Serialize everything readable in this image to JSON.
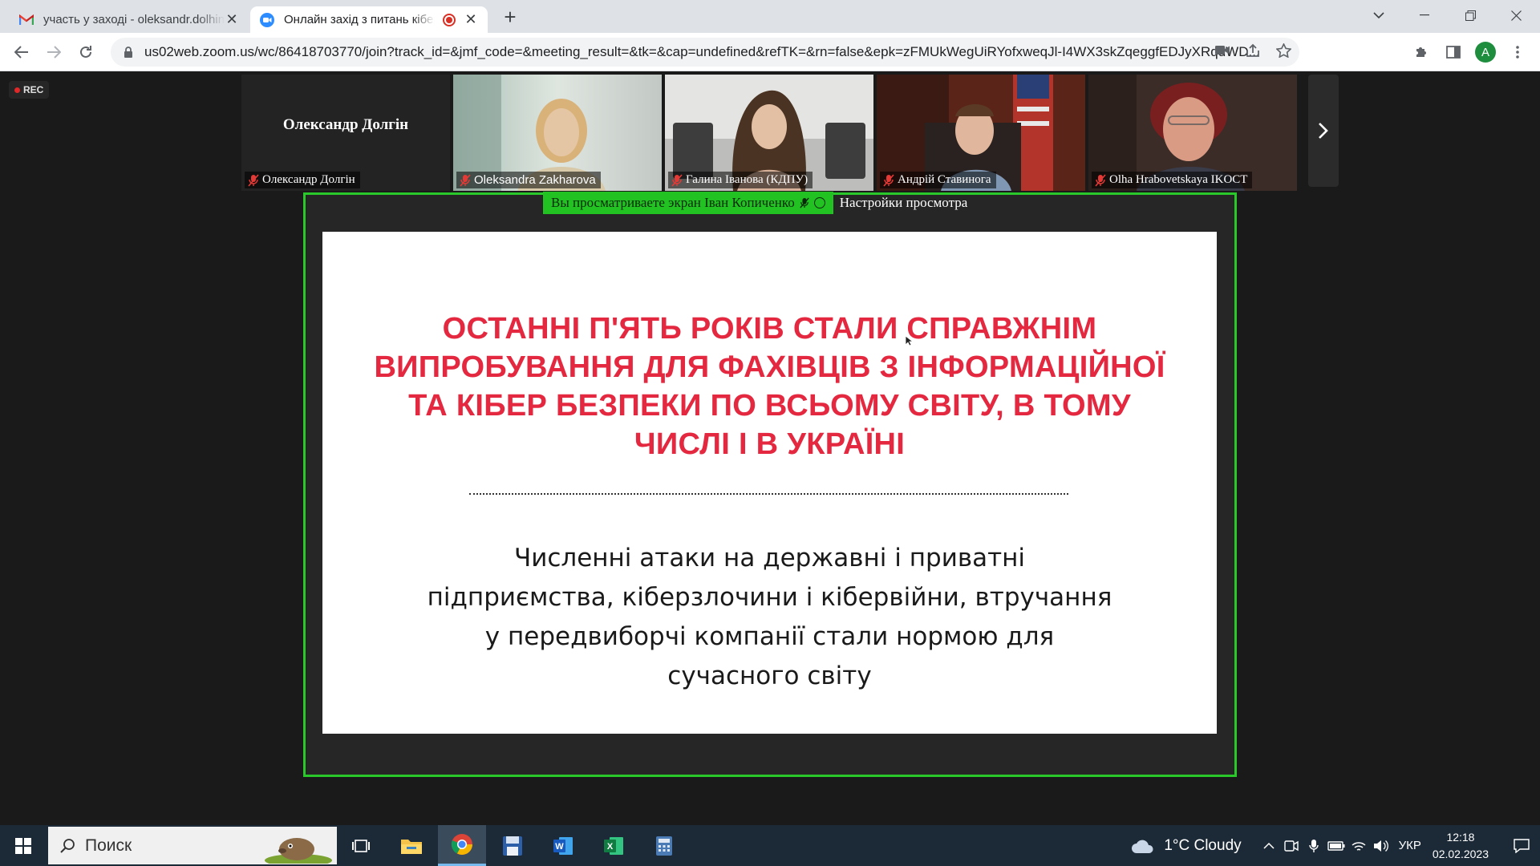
{
  "browser": {
    "tabs": [
      {
        "title": "участь у заході - oleksandr.dolhin",
        "icon": "gmail-icon",
        "active": false
      },
      {
        "title": "Онлайн захід з питань кібербезпеки",
        "icon": "zoom-icon",
        "active": true
      }
    ],
    "address": "us02web.zoom.us/wc/86418703770/join?track_id=&jmf_code=&meeting_result=&tk=&cap=undefined&refTK=&rn=false&epk=zFMUkWegUiRYofxweqJl-I4WX3skZqeggfEDJyXRqdWD...",
    "profile_initial": "A"
  },
  "meeting": {
    "rec_label": "REC",
    "participants": [
      {
        "name": "Олександр Долгін",
        "video": false,
        "muted": true
      },
      {
        "name": "Oleksandra Zakharova",
        "video": true,
        "muted": true,
        "label_font": "sans"
      },
      {
        "name": "Галина Іванова (КДПУ)",
        "video": true,
        "muted": true
      },
      {
        "name": "Андрій Ставинога",
        "video": true,
        "muted": true
      },
      {
        "name": "Olha Hrabovetskaya IKOCT",
        "video": true,
        "muted": true
      }
    ],
    "share_banner": {
      "viewing_text": "Вы просматриваете экран Іван Копиченко",
      "view_options": "Настройки просмотра"
    },
    "slide": {
      "heading": "ОСТАННІ П'ЯТЬ РОКІВ СТАЛИ СПРАВЖНІМ ВИПРОБУВАННЯ ДЛЯ ФАХІВЦІВ З ІНФОРМАЦІЙНОЇ ТА КІБЕР БЕЗПЕКИ ПО ВСЬОМУ СВІТУ, В ТОМУ ЧИСЛІ І В УКРАЇНІ",
      "body": "Численні атаки на державні і приватні підприємства, кіберзлочини і кібервійни, втручання у передвиборчі компанії стали нормою для сучасного світу",
      "heading_color": "#e4283f"
    },
    "share_border_color": "#2bc82b"
  },
  "taskbar": {
    "search_placeholder": "Поиск",
    "weather_text": "1°C  Cloudy",
    "language": "УКР",
    "time": "12:18",
    "date": "02.02.2023",
    "apps": [
      "task-view-icon",
      "file-explorer-icon",
      "chrome-icon",
      "save-app-icon",
      "word-icon",
      "excel-icon",
      "calculator-icon"
    ]
  }
}
